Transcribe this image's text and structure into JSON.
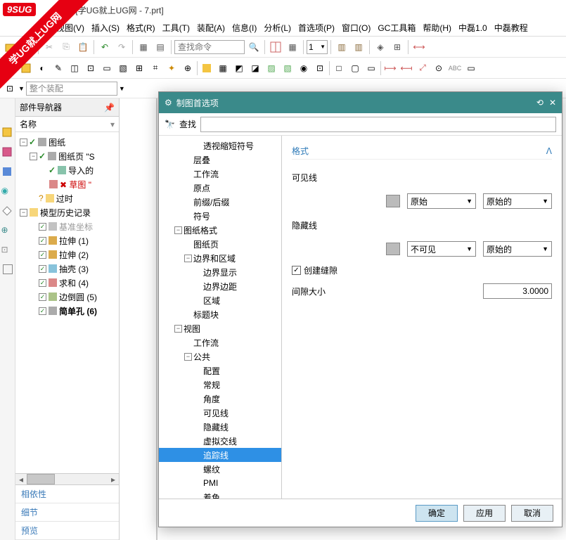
{
  "watermark": {
    "tag": "9SUG",
    "banner": "学UG就上UG网"
  },
  "title": " - [学UG就上UG网 - 7.prt]",
  "menu": {
    "view": "视图(V)",
    "insert": "插入(S)",
    "format": "格式(R)",
    "tools": "工具(T)",
    "assy": "装配(A)",
    "info": "信息(I)",
    "analyze": "分析(L)",
    "pref": "首选项(P)",
    "window": "窗口(O)",
    "gc": "GC工具箱",
    "help": "帮助(H)",
    "zl1": "中磊1.0",
    "zl2": "中磊教程"
  },
  "toolbar": {
    "cmd_placeholder": "查找命令",
    "dd1": "1"
  },
  "assy_dd": "整个装配",
  "navigator": {
    "title": "部件导航器",
    "col_name": "名称",
    "tree": [
      {
        "ind": 0,
        "exp": "-",
        "chk": true,
        "icon": "drawing",
        "label": "图纸"
      },
      {
        "ind": 1,
        "exp": "-",
        "chk": true,
        "icon": "sheet",
        "label": "图纸页 \"S"
      },
      {
        "ind": 2,
        "chk": true,
        "icon": "import",
        "label": "导入的"
      },
      {
        "ind": 2,
        "icon": "sketch",
        "label": "草图 \"",
        "red": true
      },
      {
        "ind": 1,
        "help": true,
        "icon": "folder",
        "label": "过时"
      },
      {
        "ind": 0,
        "exp": "-",
        "icon": "folder-open",
        "label": "模型历史记录"
      },
      {
        "ind": 1,
        "cbox": true,
        "icon": "csys",
        "label": "基准坐标",
        "gray": true
      },
      {
        "ind": 1,
        "cbox": true,
        "icon": "extrude",
        "label": "拉伸 (1)"
      },
      {
        "ind": 1,
        "cbox": true,
        "icon": "extrude",
        "label": "拉伸 (2)"
      },
      {
        "ind": 1,
        "cbox": true,
        "icon": "shell",
        "label": "抽壳 (3)"
      },
      {
        "ind": 1,
        "cbox": true,
        "icon": "unite",
        "label": "求和 (4)"
      },
      {
        "ind": 1,
        "cbox": true,
        "icon": "blend",
        "label": "边倒圆 (5)"
      },
      {
        "ind": 1,
        "cbox": true,
        "icon": "hole",
        "label": "简单孔 (6)",
        "bold": true
      }
    ],
    "panels": {
      "dep": "相依性",
      "detail": "细节",
      "preview": "预览"
    }
  },
  "dialog": {
    "title": "制图首选项",
    "search_label": "查找",
    "tree": [
      {
        "ind": 3,
        "label": "透视缩短符号"
      },
      {
        "ind": 2,
        "label": "层叠"
      },
      {
        "ind": 2,
        "label": "工作流"
      },
      {
        "ind": 2,
        "label": "原点"
      },
      {
        "ind": 2,
        "label": "前缀/后缀"
      },
      {
        "ind": 2,
        "label": "符号"
      },
      {
        "ind": 1,
        "exp": "-",
        "label": "图纸格式"
      },
      {
        "ind": 2,
        "label": "图纸页"
      },
      {
        "ind": 2,
        "exp": "-",
        "label": "边界和区域"
      },
      {
        "ind": 3,
        "label": "边界显示"
      },
      {
        "ind": 3,
        "label": "边界边距"
      },
      {
        "ind": 3,
        "label": "区域"
      },
      {
        "ind": 2,
        "label": "标题块"
      },
      {
        "ind": 1,
        "exp": "-",
        "label": "视图"
      },
      {
        "ind": 2,
        "label": "工作流"
      },
      {
        "ind": 2,
        "exp": "-",
        "label": "公共"
      },
      {
        "ind": 3,
        "label": "配置"
      },
      {
        "ind": 3,
        "label": "常规"
      },
      {
        "ind": 3,
        "label": "角度"
      },
      {
        "ind": 3,
        "label": "可见线"
      },
      {
        "ind": 3,
        "label": "隐藏线"
      },
      {
        "ind": 3,
        "label": "虚拟交线"
      },
      {
        "ind": 3,
        "label": "追踪线",
        "sel": true
      },
      {
        "ind": 3,
        "label": "螺纹"
      },
      {
        "ind": 3,
        "label": "PMI"
      },
      {
        "ind": 3,
        "label": "着色"
      }
    ],
    "section": {
      "header": "格式",
      "visible_label": "可见线",
      "visible_sel1": "原始",
      "visible_sel2": "原始的",
      "hidden_label": "隐藏线",
      "hidden_sel1": "不可见",
      "hidden_sel2": "原始的",
      "create_gap": "创建缝隙",
      "gap_size_label": "间隙大小",
      "gap_size_value": "3.0000"
    },
    "buttons": {
      "ok": "确定",
      "apply": "应用",
      "cancel": "取消"
    }
  }
}
